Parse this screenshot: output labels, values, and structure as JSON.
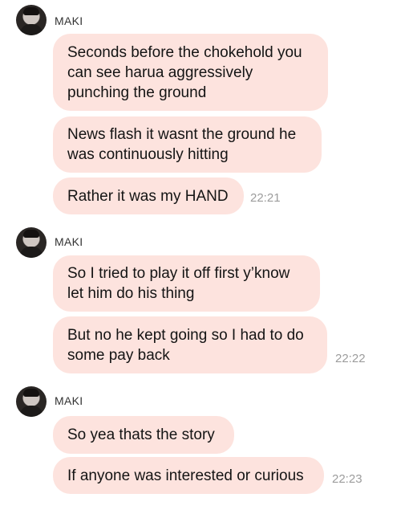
{
  "groups": [
    {
      "sender": "MAKI",
      "messages": [
        {
          "text": "Seconds before the chokehold you\ncan see harua aggressively\npunching the ground"
        },
        {
          "text": "News flash it wasnt the ground he\nwas continuously hitting"
        },
        {
          "text": "Rather it was my HAND",
          "time": "22:21"
        }
      ]
    },
    {
      "sender": "MAKI",
      "messages": [
        {
          "text": "So I tried to play it off first y’know\nlet him do his thing"
        },
        {
          "text": "But no he kept going so I had to do\nsome pay back",
          "time": "22:22"
        }
      ]
    },
    {
      "sender": "MAKI",
      "messages": [
        {
          "text": "So yea thats the story"
        },
        {
          "text": "If anyone was interested or curious",
          "time": "22:23"
        }
      ]
    }
  ],
  "colors": {
    "bubble": "#fde3de",
    "timestamp": "#9c9c9c",
    "background": "#ffffff"
  }
}
